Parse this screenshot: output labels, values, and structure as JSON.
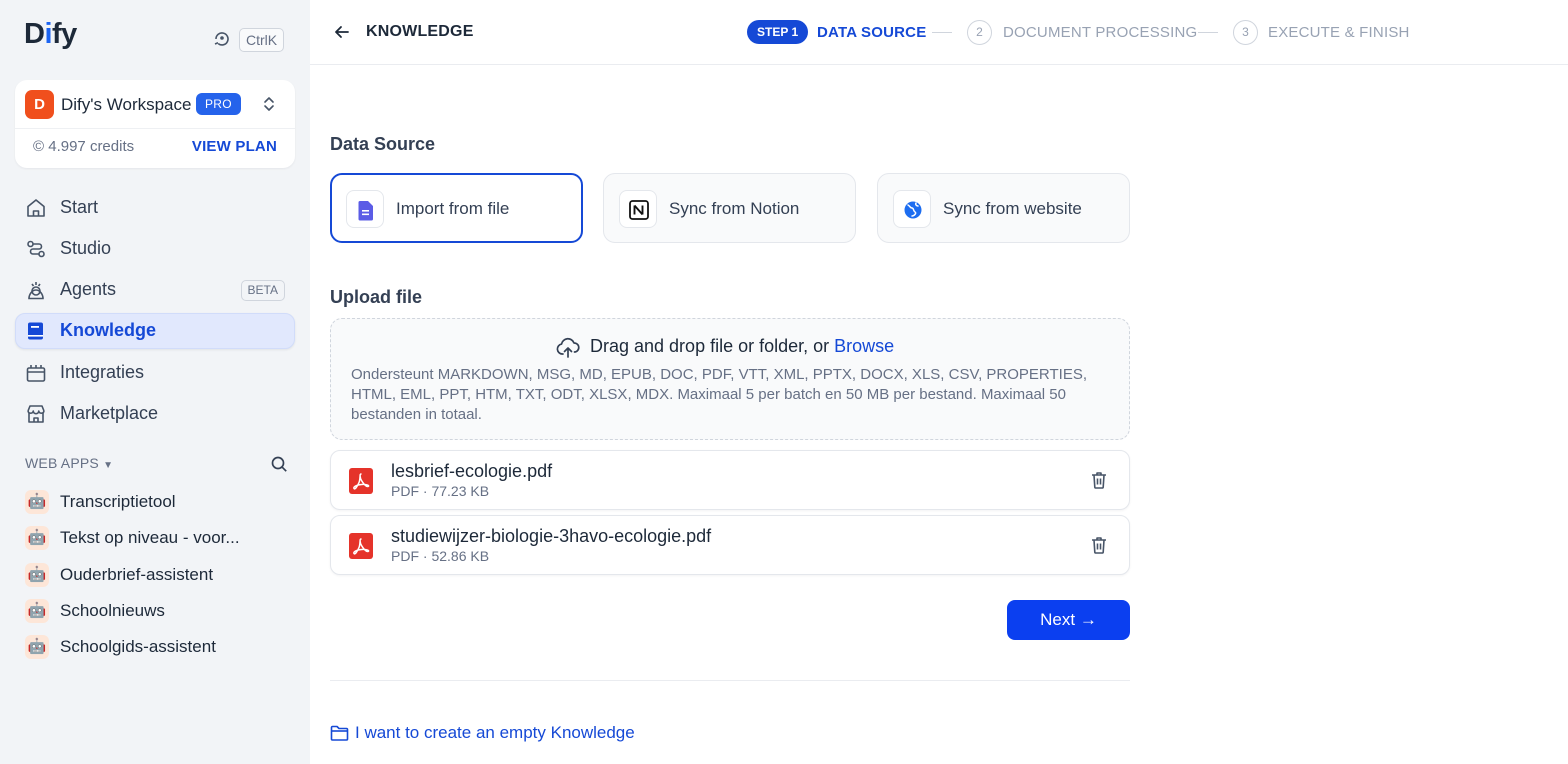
{
  "app": {
    "logo": "Dify",
    "shortcut": "CtrlK"
  },
  "workspace": {
    "avatar_letter": "D",
    "name": "Dify's Workspace",
    "plan_badge": "PRO",
    "credits": "4.997 credits",
    "view_plan": "VIEW PLAN"
  },
  "nav": {
    "items": [
      {
        "label": "Start",
        "icon": "home-icon"
      },
      {
        "label": "Studio",
        "icon": "studio-icon"
      },
      {
        "label": "Agents",
        "icon": "agent-icon",
        "badge": "BETA"
      },
      {
        "label": "Knowledge",
        "icon": "book-icon",
        "active": true
      },
      {
        "label": "Integraties",
        "icon": "integrations-icon"
      },
      {
        "label": "Marketplace",
        "icon": "store-icon"
      }
    ]
  },
  "webapps": {
    "title": "WEB APPS",
    "items": [
      {
        "label": "Transcriptietool"
      },
      {
        "label": "Tekst op niveau - voor..."
      },
      {
        "label": "Ouderbrief-assistent"
      },
      {
        "label": "Schoolnieuws"
      },
      {
        "label": "Schoolgids-assistent"
      }
    ]
  },
  "header": {
    "title": "KNOWLEDGE",
    "steps": [
      {
        "badge": "STEP 1",
        "label": "DATA SOURCE",
        "active": true
      },
      {
        "number": "2",
        "label": "DOCUMENT PROCESSING"
      },
      {
        "number": "3",
        "label": "EXECUTE & FINISH"
      }
    ]
  },
  "data_source": {
    "title": "Data Source",
    "options": [
      {
        "label": "Import from file",
        "icon": "file-icon",
        "selected": true
      },
      {
        "label": "Sync from Notion",
        "icon": "notion-icon"
      },
      {
        "label": "Sync from website",
        "icon": "globe-icon"
      }
    ]
  },
  "upload": {
    "title": "Upload file",
    "drop_text": "Drag and drop file or folder, or ",
    "browse": "Browse",
    "help": "Ondersteunt MARKDOWN, MSG, MD, EPUB, DOC, PDF, VTT, XML, PPTX, DOCX, XLS, CSV, PROPERTIES, HTML, EML, PPT, HTM, TXT, ODT, XLSX, MDX. Maximaal 5 per batch en 50 MB per bestand. Maximaal 50 bestanden in totaal.",
    "files": [
      {
        "name": "lesbrief-ecologie.pdf",
        "meta": "PDF · 77.23 KB"
      },
      {
        "name": "studiewijzer-biologie-3havo-ecologie.pdf",
        "meta": "PDF · 52.86 KB"
      }
    ]
  },
  "actions": {
    "next": "Next",
    "empty_knowledge": "I want to create an empty Knowledge"
  },
  "colors": {
    "accent": "#1549d6",
    "primary_button": "#0b3ff0",
    "pdf_red": "#e5332a",
    "workspace_avatar": "#f04f1d"
  }
}
